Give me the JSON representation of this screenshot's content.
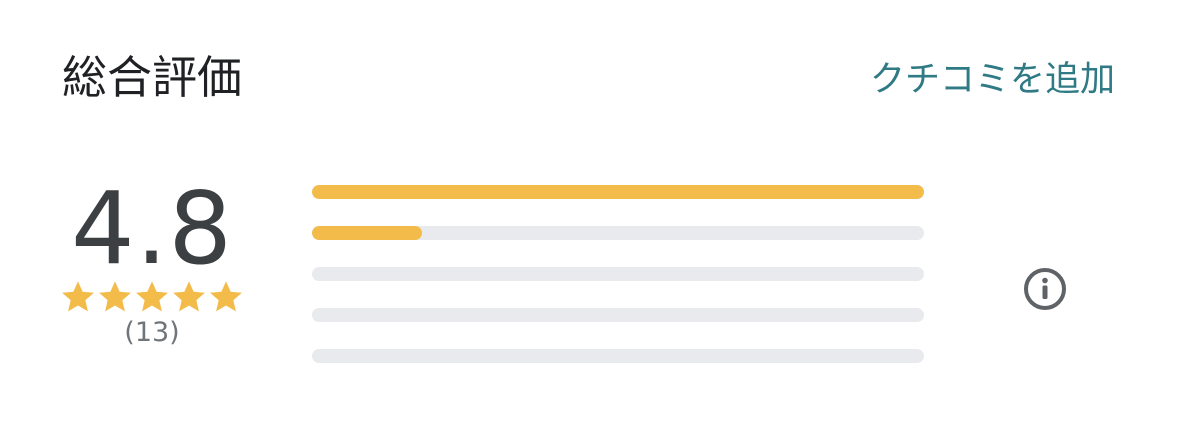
{
  "header": {
    "title": "総合評価",
    "add_review_label": "クチコミを追加"
  },
  "rating": {
    "score": "4.8",
    "stars": 5,
    "count_label": "(13)"
  },
  "distribution": [
    {
      "stars": 5,
      "fraction": 1.0
    },
    {
      "stars": 4,
      "fraction": 0.18
    },
    {
      "stars": 3,
      "fraction": 0
    },
    {
      "stars": 2,
      "fraction": 0
    },
    {
      "stars": 1,
      "fraction": 0
    }
  ],
  "icons": {
    "star": "star-icon",
    "info": "info-icon"
  },
  "colors": {
    "accent": "#2f7a84",
    "star": "#f2bb4a",
    "bar_track": "#e8eaed",
    "text": "#202124",
    "muted": "#70757a"
  }
}
